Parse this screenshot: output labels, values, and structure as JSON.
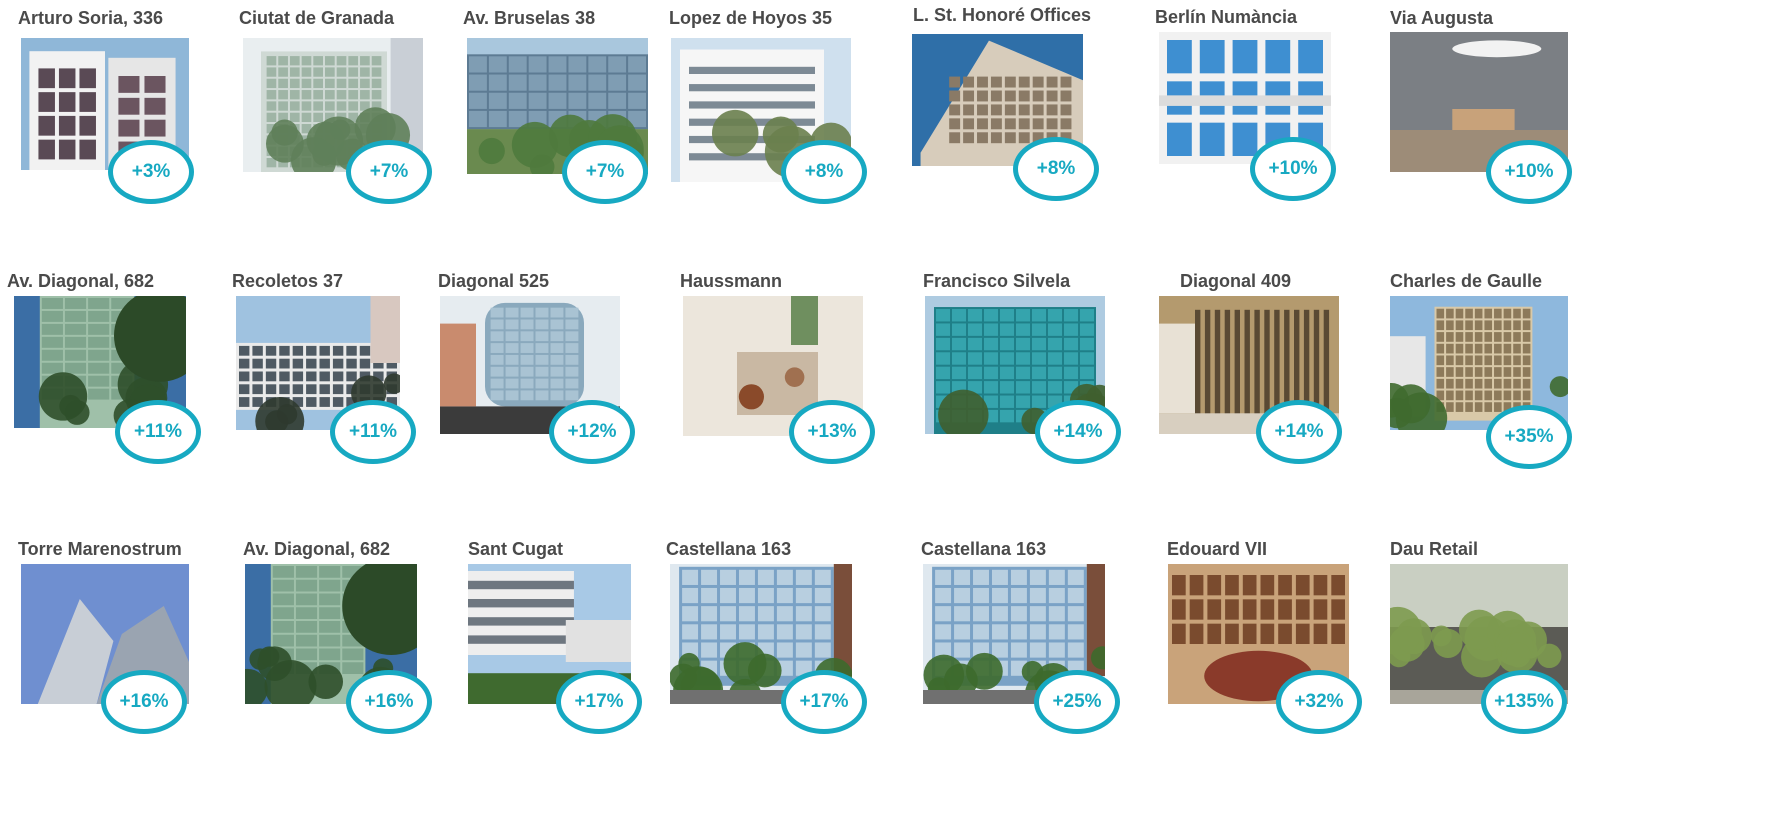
{
  "colors": {
    "accent": "#17a9c2",
    "title_text": "#4a4a4a",
    "background": "#ffffff"
  },
  "properties": [
    {
      "name": "Arturo Soria, 336",
      "uplift": "+3%",
      "photo": "building-photo",
      "tone": "white-tower"
    },
    {
      "name": "Ciutat de Granada",
      "uplift": "+7%",
      "photo": "building-photo",
      "tone": "green-facade"
    },
    {
      "name": "Av. Bruselas 38",
      "uplift": "+7%",
      "photo": "building-photo",
      "tone": "glass-garden"
    },
    {
      "name": "Lopez de Hoyos 35",
      "uplift": "+8%",
      "photo": "building-photo",
      "tone": "white-office"
    },
    {
      "name": "L. St. Honoré Offices",
      "uplift": "+8%",
      "photo": "building-photo",
      "tone": "classic-blue"
    },
    {
      "name": "Berlín Numància",
      "uplift": "+10%",
      "photo": "building-photo",
      "tone": "blue-glass"
    },
    {
      "name": "Via Augusta",
      "uplift": "+10%",
      "photo": "lobby-photo",
      "tone": "interior-grey"
    },
    {
      "name": "Av. Diagonal, 682",
      "uplift": "+11%",
      "photo": "building-photo",
      "tone": "green-glass-trees"
    },
    {
      "name": "Recoletos 37",
      "uplift": "+11%",
      "photo": "building-photo",
      "tone": "white-grid"
    },
    {
      "name": "Diagonal 525",
      "uplift": "+12%",
      "photo": "building-photo",
      "tone": "glass-curve"
    },
    {
      "name": "Haussmann",
      "uplift": "+13%",
      "photo": "interior-photo",
      "tone": "interior-warm"
    },
    {
      "name": "Francisco Silvela",
      "uplift": "+14%",
      "photo": "building-photo",
      "tone": "teal-towers"
    },
    {
      "name": "Diagonal 409",
      "uplift": "+14%",
      "photo": "interior-photo",
      "tone": "interior-gold"
    },
    {
      "name": "Charles de Gaulle",
      "uplift": "+35%",
      "photo": "building-photo",
      "tone": "beige-block"
    },
    {
      "name": "Torre Marenostrum",
      "uplift": "+16%",
      "photo": "building-photo",
      "tone": "silver-tower"
    },
    {
      "name": "Av. Diagonal, 682",
      "uplift": "+16%",
      "photo": "building-photo",
      "tone": "green-glass-trees"
    },
    {
      "name": "Sant Cugat",
      "uplift": "+17%",
      "photo": "building-photo",
      "tone": "white-campus"
    },
    {
      "name": "Castellana 163",
      "uplift": "+17%",
      "photo": "building-photo",
      "tone": "glass-street"
    },
    {
      "name": "Castellana 163",
      "uplift": "+25%",
      "photo": "building-photo",
      "tone": "glass-street"
    },
    {
      "name": "Edouard VII",
      "uplift": "+32%",
      "photo": "building-photo",
      "tone": "ornate-court"
    },
    {
      "name": "Dau Retail",
      "uplift": "+135%",
      "photo": "building-photo",
      "tone": "street-trees"
    }
  ]
}
